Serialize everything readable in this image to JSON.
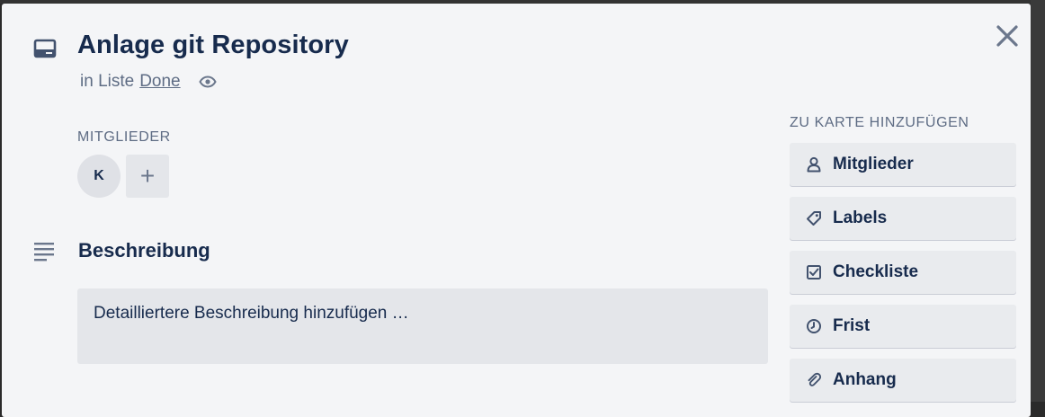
{
  "card": {
    "title": "Anlage git Repository",
    "list_prefix": "in Liste",
    "list_name": "Done"
  },
  "members": {
    "label": "MITGLIEDER",
    "avatar_initial": "K",
    "add_symbol": "+"
  },
  "description": {
    "heading": "Beschreibung",
    "placeholder": "Detailliertere Beschreibung hinzufügen …"
  },
  "sidebar": {
    "label": "ZU KARTE HINZUFÜGEN",
    "buttons": [
      {
        "label": "Mitglieder",
        "icon": "person-icon"
      },
      {
        "label": "Labels",
        "icon": "tag-icon"
      },
      {
        "label": "Checkliste",
        "icon": "checkbox-icon"
      },
      {
        "label": "Frist",
        "icon": "clock-icon"
      },
      {
        "label": "Anhang",
        "icon": "paperclip-icon"
      }
    ]
  },
  "colors": {
    "modal_bg": "#f4f5f7",
    "text": "#172b4d",
    "muted": "#5e6c84",
    "button_bg": "#e9ebee"
  }
}
